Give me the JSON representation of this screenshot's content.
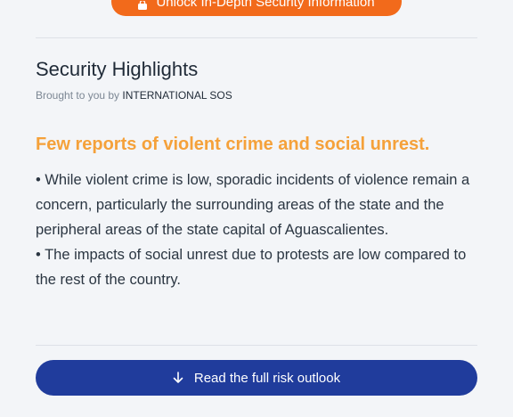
{
  "header": {
    "unlock_label": "Unlock In-Depth Security Information"
  },
  "section": {
    "title": "Security Highlights",
    "byline_prefix": "Brought to you by ",
    "byline_org": "INTERNATIONAL SOS",
    "headline": "Few reports of violent crime and social unrest.",
    "paragraphs": [
      "• While violent crime is low, sporadic incidents of violence remain a concern, particularly the surrounding areas of the state and the peripheral areas of the state capital of Aguascalientes.",
      "• The impacts of social unrest due to protests are low compared to the rest of the country."
    ]
  },
  "footer": {
    "cta_label": "Read the full risk outlook"
  },
  "colors": {
    "accent_orange": "#f26a1b",
    "headline_orange": "#f5a13a",
    "cta_blue": "#203c9c"
  },
  "icons": {
    "unlock": "lock-icon",
    "cta": "arrow-down-icon"
  }
}
